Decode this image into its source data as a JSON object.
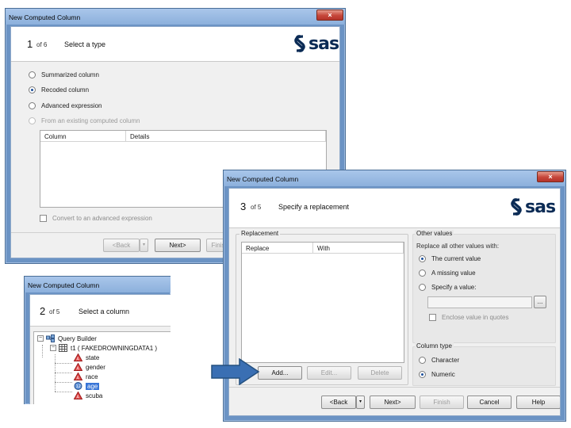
{
  "window1": {
    "title": "New Computed Column",
    "step_number": "1",
    "step_of": "of 6",
    "step_title": "Select a type",
    "options": [
      {
        "label": "Summarized column",
        "selected": false,
        "enabled": true
      },
      {
        "label": "Recoded column",
        "selected": true,
        "enabled": true
      },
      {
        "label": "Advanced expression",
        "selected": false,
        "enabled": true
      },
      {
        "label": "From an existing computed column",
        "selected": false,
        "enabled": false
      }
    ],
    "table_headers": [
      "Column",
      "Details"
    ],
    "convert_checkbox": "Convert to an advanced expression",
    "buttons": {
      "back": "<Back",
      "next": "Next>",
      "finish": "Finis"
    }
  },
  "window2": {
    "title": "New Computed Column",
    "step_number": "2",
    "step_of": "of 5",
    "step_title": "Select a column",
    "tree": {
      "root": "Query Builder",
      "table": "t1 ( FAKEDROWNINGDATA1 )",
      "columns": [
        "state",
        "gender",
        "race",
        "age",
        "scuba"
      ],
      "selected_column": "age"
    }
  },
  "window3": {
    "title": "New Computed Column",
    "step_number": "3",
    "step_of": "of 5",
    "step_title": "Specify a replacement",
    "replacement": {
      "group_label": "Replacement",
      "headers": [
        "Replace",
        "With"
      ],
      "buttons": {
        "add": "Add...",
        "edit": "Edit...",
        "delete": "Delete"
      }
    },
    "other_values": {
      "group_label": "Other values",
      "prompt": "Replace all other values with:",
      "options": [
        {
          "label": "The current value",
          "selected": true
        },
        {
          "label": "A missing value",
          "selected": false
        },
        {
          "label": "Specify a value:",
          "selected": false
        }
      ],
      "browse_button": "...",
      "enclose_checkbox": "Enclose value in quotes"
    },
    "column_type": {
      "group_label": "Column type",
      "options": [
        {
          "label": "Character",
          "selected": false
        },
        {
          "label": "Numeric",
          "selected": true
        }
      ]
    },
    "buttons": {
      "back": "<Back",
      "next": "Next>",
      "finish": "Finish",
      "cancel": "Cancel",
      "help": "Help"
    }
  },
  "brand": {
    "logo_text": "sas",
    "logo_color": "#0b2b55"
  },
  "colors": {
    "arrow": "#3a6fb3",
    "title_bar": "#8cb0dc",
    "close_button": "#c6463a",
    "selection": "#3875d7"
  },
  "icons": {
    "close": "×",
    "dropdown": "▾"
  }
}
